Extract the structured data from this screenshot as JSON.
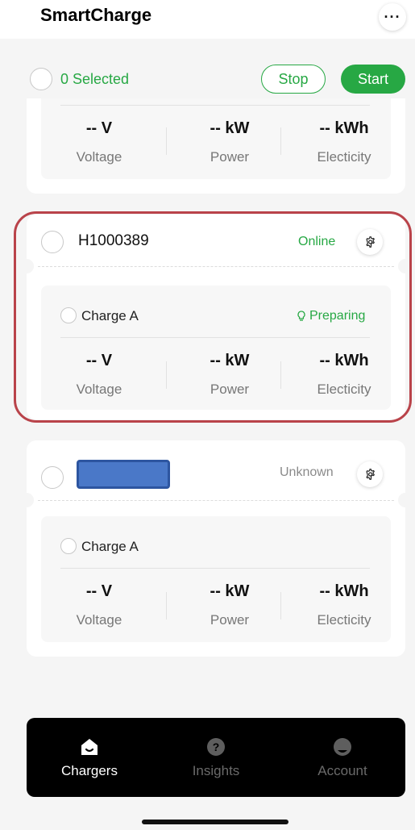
{
  "app": {
    "title": "SmartCharge"
  },
  "selection": {
    "count_label": "0 Selected",
    "stop_label": "Stop",
    "start_label": "Start"
  },
  "chargers": [
    {
      "name": "",
      "status": "",
      "connector": {
        "name": "",
        "status": "",
        "metrics": [
          {
            "value": "-- V",
            "label": "Voltage"
          },
          {
            "value": "-- kW",
            "label": "Power"
          },
          {
            "value": "-- kWh",
            "label": "Electicity"
          }
        ]
      }
    },
    {
      "name": "H1000389",
      "status": "Online",
      "connector": {
        "name": "Charge A",
        "status": "Preparing",
        "metrics": [
          {
            "value": "-- V",
            "label": "Voltage"
          },
          {
            "value": "-- kW",
            "label": "Power"
          },
          {
            "value": "-- kWh",
            "label": "Electicity"
          }
        ]
      }
    },
    {
      "name": "",
      "status": "Unknown",
      "connector": {
        "name": "Charge A",
        "status": "",
        "metrics": [
          {
            "value": "-- V",
            "label": "Voltage"
          },
          {
            "value": "-- kW",
            "label": "Power"
          },
          {
            "value": "-- kWh",
            "label": "Electicity"
          }
        ]
      }
    }
  ],
  "tabs": [
    {
      "label": "Chargers",
      "icon": "home-icon",
      "active": true
    },
    {
      "label": "Insights",
      "icon": "question-icon",
      "active": false
    },
    {
      "label": "Account",
      "icon": "user-icon",
      "active": false
    }
  ],
  "colors": {
    "accent": "#27a844",
    "highlight": "#b9434a",
    "redaction": "#4a78c8",
    "tabbar": "#000000"
  }
}
